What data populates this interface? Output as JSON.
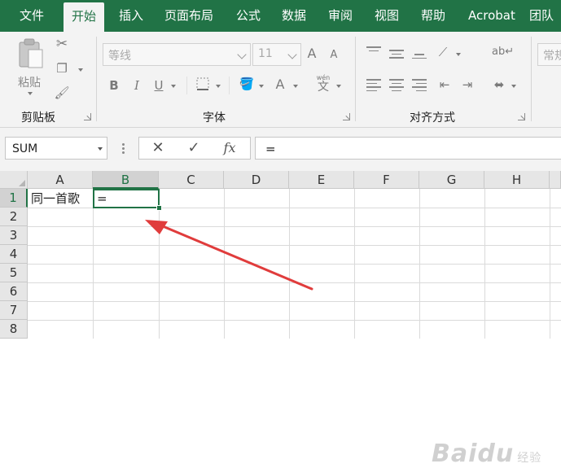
{
  "tabs": [
    "文件",
    "开始",
    "插入",
    "页面布局",
    "公式",
    "数据",
    "审阅",
    "视图",
    "帮助",
    "Acrobat",
    "团队"
  ],
  "active_tab": "开始",
  "colors": {
    "accent": "#217346",
    "arrow": "#e03c3c"
  },
  "ribbon": {
    "clipboard": {
      "paste_label": "粘贴",
      "group_label": "剪贴板",
      "icons": [
        "paste-icon",
        "cut-icon",
        "copy-icon",
        "format-painter-icon"
      ]
    },
    "font": {
      "font_name": "等线",
      "font_size": "11",
      "grow_label": "A",
      "shrink_label": "A",
      "bold": "B",
      "italic": "I",
      "underline": "U",
      "font_color_label": "A",
      "phonetic_label": "wén",
      "phonetic_char": "文",
      "group_label": "字体"
    },
    "alignment": {
      "group_label": "对齐方式"
    },
    "number": {
      "format_label": "常规"
    }
  },
  "formula_bar": {
    "name_box": "SUM",
    "cancel_symbol": "✕",
    "enter_symbol": "✓",
    "fx_symbol": "fx",
    "content": "="
  },
  "grid": {
    "columns": [
      "A",
      "B",
      "C",
      "D",
      "E",
      "F",
      "G",
      "H"
    ],
    "rows": [
      "1",
      "2",
      "3",
      "4",
      "5",
      "6",
      "7",
      "8"
    ],
    "selected_column": "B",
    "selected_row": "1",
    "cells": {
      "A1": "同一首歌",
      "B1": "="
    }
  },
  "watermark": {
    "brand": "Baidu",
    "suffix": "经验"
  }
}
